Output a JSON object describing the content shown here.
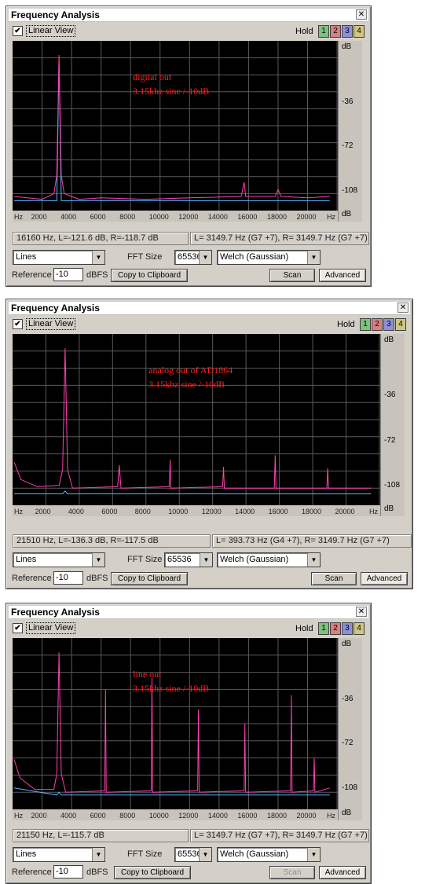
{
  "windows": [
    {
      "title": "Frequency Analysis",
      "linear_view_label": "Linear View",
      "hold_label": "Hold",
      "hold_buttons": [
        "1",
        "2",
        "3",
        "4"
      ],
      "annotation": [
        "digital out",
        "3.15khz sine /-10dB"
      ],
      "y_axis_labels": {
        "top": "dB",
        "a": "-36",
        "b": "-72",
        "c": "-108",
        "bottom": "dB"
      },
      "x_axis_labels": [
        "Hz",
        "2000",
        "4000",
        "6000",
        "8000",
        "10000",
        "12000",
        "14000",
        "16000",
        "18000",
        "20000",
        "Hz"
      ],
      "cursor_readout": "16160 Hz, L=-121.6 dB, R=-118.7 dB",
      "peak_readout": "L= 3149.7 Hz (G7 +7), R= 3149.7 Hz (G7 +7)",
      "mode_select": "Lines",
      "fft_size_label": "FFT Size",
      "fft_size": "65536",
      "window_select": "Welch (Gaussian)",
      "reference_label": "Reference",
      "reference_value": "-10",
      "reference_unit": "dBFS",
      "copy_button": "Copy to Clipboard",
      "scan_button": "Scan",
      "advanced_button": "Advanced"
    },
    {
      "title": "Frequency Analysis",
      "linear_view_label": "Linear View",
      "hold_label": "Hold",
      "hold_buttons": [
        "1",
        "2",
        "3",
        "4"
      ],
      "annotation": [
        "analog out of AD1864",
        "3.15khz sine /-10dB"
      ],
      "y_axis_labels": {
        "top": "dB",
        "a": "-36",
        "b": "-72",
        "c": "-108",
        "bottom": "dB"
      },
      "x_axis_labels": [
        "Hz",
        "2000",
        "4000",
        "6000",
        "8000",
        "10000",
        "12000",
        "14000",
        "16000",
        "18000",
        "20000",
        "Hz"
      ],
      "cursor_readout": "21510 Hz, L=-136.3 dB, R=-117.5 dB",
      "peak_readout": "L= 393.73 Hz (G4 +7), R= 3149.7 Hz (G7 +7)",
      "mode_select": "Lines",
      "fft_size_label": "FFT Size",
      "fft_size": "65536",
      "window_select": "Welch (Gaussian)",
      "reference_label": "Reference",
      "reference_value": "-10",
      "reference_unit": "dBFS",
      "copy_button": "Copy to Clipboard",
      "scan_button": "Scan",
      "advanced_button": "Advanced"
    },
    {
      "title": "Frequency Analysis",
      "linear_view_label": "Linear View",
      "hold_label": "Hold",
      "hold_buttons": [
        "1",
        "2",
        "3",
        "4"
      ],
      "annotation": [
        "line out",
        "3.15khz sine /-10dB"
      ],
      "y_axis_labels": {
        "top": "dB",
        "a": "-36",
        "b": "-72",
        "c": "-108",
        "bottom": "dB"
      },
      "x_axis_labels": [
        "Hz",
        "2000",
        "4000",
        "6000",
        "8000",
        "10000",
        "12000",
        "14000",
        "16000",
        "18000",
        "20000",
        "Hz"
      ],
      "cursor_readout": "21150 Hz, L=-115.7 dB",
      "peak_readout": "L= 3149.7 Hz (G7 +7), R= 3149.7 Hz (G7 +7)",
      "mode_select": "Lines",
      "fft_size_label": "FFT Size",
      "fft_size": "65536",
      "window_select": "Welch (Gaussian)",
      "reference_label": "Reference",
      "reference_value": "-10",
      "reference_unit": "dBFS",
      "copy_button": "Copy to Clipboard",
      "scan_button": "Scan",
      "advanced_button": "Advanced"
    }
  ],
  "colors": {
    "hold_1": "#7fc07f",
    "hold_2": "#d87f7f",
    "hold_3": "#8f8fd8",
    "hold_4": "#cfc77f",
    "trace_right": "#ff40b0",
    "trace_left": "#5ab4ff",
    "annotation": "#ff2020",
    "grid": "#5a5a5a"
  },
  "chart_data": [
    {
      "type": "line",
      "x_unit": "Hz",
      "y_unit": "dB",
      "xlim": [
        0,
        22050
      ],
      "ylim": [
        -120,
        0
      ],
      "grid": true,
      "series": [
        {
          "color_key": "trace_right",
          "points": [
            [
              100,
              -110
            ],
            [
              1000,
              -111
            ],
            [
              2000,
              -112
            ],
            [
              2800,
              -108
            ],
            [
              3000,
              -95
            ],
            [
              3149.7,
              -10
            ],
            [
              3300,
              -95
            ],
            [
              3500,
              -108
            ],
            [
              4500,
              -112
            ],
            [
              6000,
              -111
            ],
            [
              9000,
              -112
            ],
            [
              12000,
              -111
            ],
            [
              15500,
              -110
            ],
            [
              15700,
              -100
            ],
            [
              15800,
              -110
            ],
            [
              17800,
              -110
            ],
            [
              18000,
              -105
            ],
            [
              18200,
              -110
            ],
            [
              20000,
              -111
            ],
            [
              21500,
              -110
            ]
          ]
        },
        {
          "color_key": "trace_left",
          "points": [
            [
              100,
              -113
            ],
            [
              3000,
              -113
            ],
            [
              3149.7,
              -12
            ],
            [
              3300,
              -113
            ],
            [
              21500,
              -113
            ]
          ]
        }
      ]
    },
    {
      "type": "line",
      "x_unit": "Hz",
      "y_unit": "dB",
      "xlim": [
        0,
        22050
      ],
      "ylim": [
        -120,
        0
      ],
      "grid": true,
      "series": [
        {
          "color_key": "trace_right",
          "points": [
            [
              100,
              -90
            ],
            [
              500,
              -102
            ],
            [
              1500,
              -107
            ],
            [
              2800,
              -106
            ],
            [
              3000,
              -95
            ],
            [
              3149.7,
              -10
            ],
            [
              3300,
              -95
            ],
            [
              3600,
              -108
            ],
            [
              6300,
              -107
            ],
            [
              6400,
              -92
            ],
            [
              6500,
              -108
            ],
            [
              9400,
              -107
            ],
            [
              9450,
              -88
            ],
            [
              9500,
              -108
            ],
            [
              12600,
              -107
            ],
            [
              12650,
              -93
            ],
            [
              12700,
              -108
            ],
            [
              15700,
              -108
            ],
            [
              15750,
              -85
            ],
            [
              15800,
              -108
            ],
            [
              18850,
              -108
            ],
            [
              18900,
              -94
            ],
            [
              18950,
              -108
            ],
            [
              21500,
              -108
            ]
          ]
        },
        {
          "color_key": "trace_left",
          "points": [
            [
              100,
              -112
            ],
            [
              3000,
              -112
            ],
            [
              3149.7,
              -110
            ],
            [
              3300,
              -112
            ],
            [
              21500,
              -112
            ]
          ]
        }
      ]
    },
    {
      "type": "line",
      "x_unit": "Hz",
      "y_unit": "dB",
      "xlim": [
        0,
        22050
      ],
      "ylim": [
        -120,
        0
      ],
      "grid": true,
      "series": [
        {
          "color_key": "trace_right",
          "points": [
            [
              100,
              -85
            ],
            [
              500,
              -98
            ],
            [
              1500,
              -106
            ],
            [
              2800,
              -106
            ],
            [
              3000,
              -95
            ],
            [
              3149.7,
              -10
            ],
            [
              3300,
              -95
            ],
            [
              3600,
              -108
            ],
            [
              6250,
              -107
            ],
            [
              6300,
              -36
            ],
            [
              6350,
              -108
            ],
            [
              9400,
              -107
            ],
            [
              9450,
              -28
            ],
            [
              9500,
              -108
            ],
            [
              12550,
              -107
            ],
            [
              12600,
              -50
            ],
            [
              12650,
              -108
            ],
            [
              15700,
              -107
            ],
            [
              15750,
              -60
            ],
            [
              15800,
              -108
            ],
            [
              18850,
              -107
            ],
            [
              18900,
              -40
            ],
            [
              18950,
              -108
            ],
            [
              20400,
              -107
            ],
            [
              20450,
              -84
            ],
            [
              20500,
              -108
            ],
            [
              21500,
              -105
            ]
          ]
        },
        {
          "color_key": "trace_left",
          "points": [
            [
              100,
              -105
            ],
            [
              3000,
              -110
            ],
            [
              3149.7,
              -108
            ],
            [
              3300,
              -110
            ],
            [
              21500,
              -110
            ]
          ]
        }
      ]
    }
  ]
}
